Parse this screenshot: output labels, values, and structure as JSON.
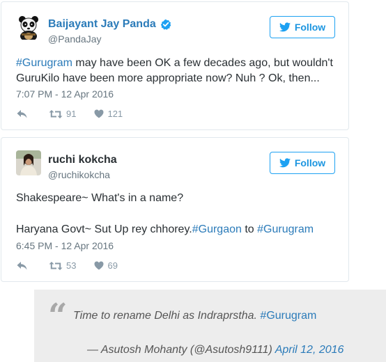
{
  "tweets": [
    {
      "name": "Baijayant Jay Panda",
      "handle": "@PandaJay",
      "verified": true,
      "follow_label": "Follow",
      "text_hashtag": "#Gurugram",
      "text_line1_rest": " may have been OK a few decades ago, but wouldn't",
      "text_line2": "GuruKilo have been more appropriate now? Nuh ? Ok, then...",
      "time": "7:07 PM - 12 Apr 2016",
      "retweets": "91",
      "likes": "121"
    },
    {
      "name": "ruchi kokcha",
      "handle": "@ruchikokcha",
      "verified": false,
      "follow_label": "Follow",
      "text_line1": "Shakespeare~ What's in a name?",
      "text_line2_prefix": "Haryana Govt~ Sut Up rey chhorey.",
      "text_line2_hashtag1": "#Gurgaon",
      "text_line2_mid": " to ",
      "text_line2_hashtag2": "#Gurugram",
      "time": "6:45 PM - 12 Apr 2016",
      "retweets": "53",
      "likes": "69"
    }
  ],
  "quote": {
    "mark": "“",
    "text": "Time to rename Delhi as Indraprstha. ",
    "hashtag": "#Gurugram",
    "byline": "— Asutosh Mohanty (@Asutosh9111) ",
    "date_link": "April 12, 2016"
  },
  "colors": {
    "link": "#2b7bb9",
    "twitter_blue": "#1da1f2",
    "muted": "#66757f",
    "quote_bg": "#ededed"
  },
  "icons": [
    "panda-avatar-icon",
    "verified-badge-icon",
    "twitter-bird-icon",
    "reply-icon",
    "retweet-icon",
    "heart-icon",
    "quote-mark-icon"
  ]
}
